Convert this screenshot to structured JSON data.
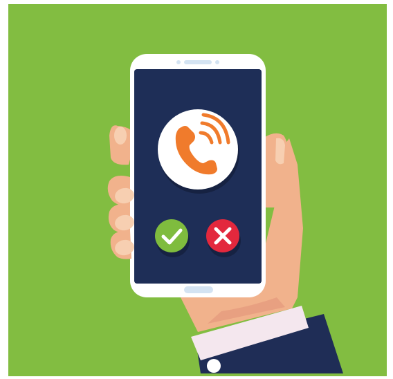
{
  "illustration": {
    "subject": "incoming-call",
    "colors": {
      "background": "#ffffff",
      "panel": "#82bd41",
      "skin": "#f1b28c",
      "skin_shadow": "#e2957a",
      "nail": "#f7cfb1",
      "sleeve": "#1f2d56",
      "cuff": "#f4e7ee",
      "button_dot": "#ffffff",
      "phone_body": "#ffffff",
      "phone_screen": "#1e2e57",
      "phone_trim": "#d4e3f2",
      "call_circle": "#ffffff",
      "call_icon": "#f07b2c",
      "accept": "#7fbc3e",
      "decline": "#e3283d",
      "button_shadow": "#162242"
    },
    "icons": [
      "phone-ringing-icon",
      "checkmark-icon",
      "close-x-icon"
    ],
    "buttons": [
      {
        "id": "accept",
        "icon": "checkmark-icon",
        "color": "#7fbc3e"
      },
      {
        "id": "decline",
        "icon": "close-x-icon",
        "color": "#e3283d"
      }
    ]
  }
}
